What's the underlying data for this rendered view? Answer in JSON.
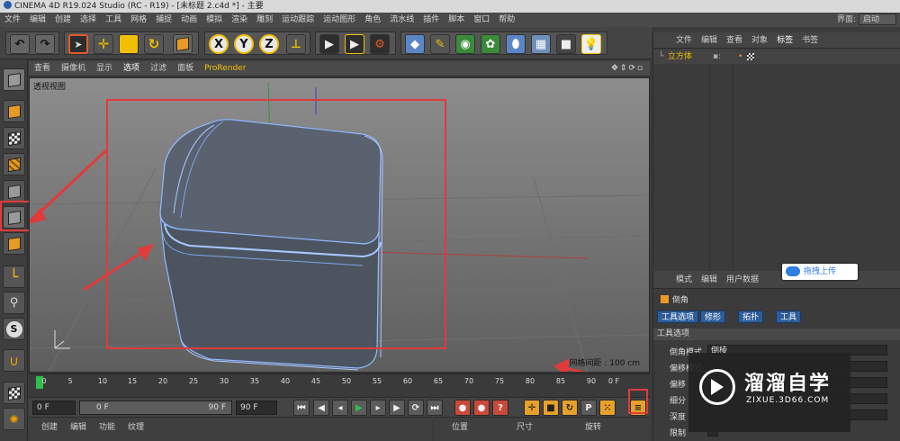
{
  "window": {
    "title": "CINEMA 4D R19.024 Studio (RC - R19) - [未标题 2.c4d *] - 主要"
  },
  "menubar": {
    "items": [
      "文件",
      "编辑",
      "创建",
      "选择",
      "工具",
      "网格",
      "捕捉",
      "动画",
      "模拟",
      "渲染",
      "雕刻",
      "运动跟踪",
      "运动图形",
      "角色",
      "流水线",
      "插件",
      "脚本",
      "窗口",
      "帮助"
    ],
    "layout_label": "界面:",
    "layout_value": "启动"
  },
  "toolbar": {
    "axis_labels": [
      "X",
      "Y",
      "Z"
    ],
    "icons": [
      "undo-icon",
      "redo-icon",
      "live-select-icon",
      "move-icon",
      "scale-icon",
      "rotate-icon",
      "recent-tools-icon",
      "x-axis-icon",
      "y-axis-icon",
      "z-axis-icon",
      "coordinate-system-icon",
      "render-view-icon",
      "render-picture-viewer-icon",
      "edit-render-settings-icon",
      "cube-primitive-icon",
      "pen-spline-icon",
      "subdivision-icon",
      "array-icon",
      "deformer-icon",
      "floor-icon",
      "camera-icon",
      "light-icon"
    ]
  },
  "lefttools": {
    "icons": [
      "make-editable-icon",
      "model-mode-icon",
      "texture-mode-icon",
      "workplane-icon",
      "points-mode-icon",
      "edges-mode-icon",
      "polygons-mode-icon",
      "enable-axis-icon",
      "tweak-icon",
      "snap-icon",
      "magnet-icon",
      "lock-icon",
      "workplane-lock-icon"
    ],
    "snap_letter": "S"
  },
  "viewport": {
    "menus": [
      "查看",
      "摄像机",
      "显示",
      "选项",
      "过滤",
      "面板",
      "ProRender"
    ],
    "label": "透视视图",
    "grid_readout": "网格间距 : 100 cm"
  },
  "timeline": {
    "ticks": [
      "0",
      "5",
      "10",
      "15",
      "20",
      "25",
      "30",
      "35",
      "40",
      "45",
      "50",
      "55",
      "60",
      "65",
      "70",
      "75",
      "80",
      "85",
      "90"
    ],
    "end_label": "0 F"
  },
  "transport": {
    "current_frame": "0 F",
    "min_frame": "0 F",
    "max_frame": "90 F",
    "end_frame": "90 F"
  },
  "bottom_left": {
    "menus": [
      "创建",
      "编辑",
      "功能",
      "纹理"
    ]
  },
  "bottom_right": {
    "headers": [
      "位置",
      "尺寸",
      "旋转"
    ]
  },
  "object_manager": {
    "menus": [
      "文件",
      "编辑",
      "查看",
      "对象",
      "标签",
      "书签"
    ],
    "objects": [
      {
        "name": "立方体"
      }
    ]
  },
  "attribute_manager": {
    "menus": [
      "模式",
      "编辑",
      "用户数据"
    ],
    "tool_name": "倒角",
    "tabs": [
      "工具选项",
      "修形",
      "拓扑",
      "工具"
    ],
    "section_title": "工具选项",
    "fields": [
      {
        "label": "倒角模式",
        "value": "倒棱"
      },
      {
        "label": "偏移模式",
        "value": ""
      },
      {
        "label": "偏移",
        "value": ""
      },
      {
        "label": "细分",
        "value": ""
      },
      {
        "label": "深度",
        "value": ""
      },
      {
        "label": "限制",
        "value": ""
      }
    ]
  },
  "upload_chip": {
    "label": "拖拽上传"
  },
  "watermark": {
    "title": "溜溜自学",
    "url": "ZIXUE.3D66.COM"
  },
  "colors": {
    "accent_yellow": "#f0c000",
    "annotation_red": "#e23a3a",
    "selection_blue": "#2d5d9a",
    "playhead_green": "#2fbf4b"
  }
}
